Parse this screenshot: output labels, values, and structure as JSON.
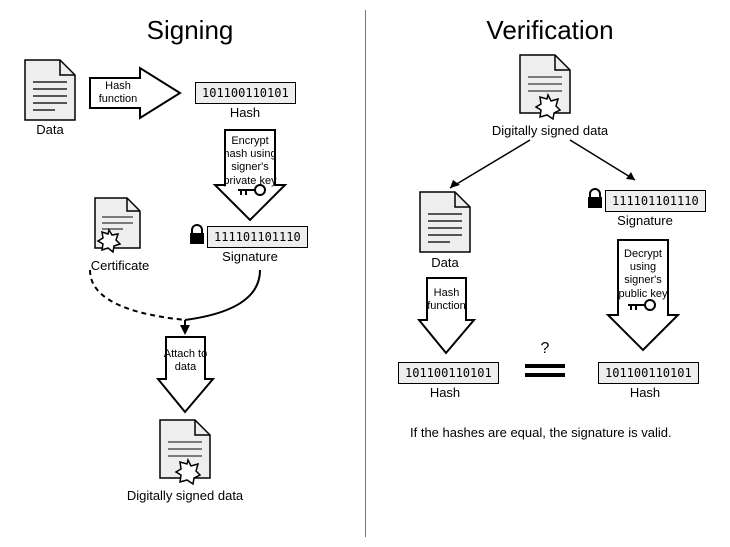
{
  "signing": {
    "title": "Signing",
    "data_label": "Data",
    "hash_function": "Hash function",
    "hash_value": "101100110101",
    "hash_label": "Hash",
    "encrypt_text": "Encrypt hash using signer's private key",
    "signature_value": "111101101110",
    "signature_label": "Signature",
    "certificate_label": "Certificate",
    "attach_text": "Attach to data",
    "signed_label": "Digitally signed data"
  },
  "verification": {
    "title": "Verification",
    "signed_label": "Digitally signed data",
    "data_label": "Data",
    "signature_value": "111101101110",
    "signature_label": "Signature",
    "hash_function": "Hash function",
    "decrypt_text": "Decrypt using signer's public key",
    "hash_left": "101100110101",
    "hash_right": "101100110101",
    "hash_label": "Hash",
    "question": "?",
    "footer": "If the hashes are equal, the signature is valid."
  }
}
